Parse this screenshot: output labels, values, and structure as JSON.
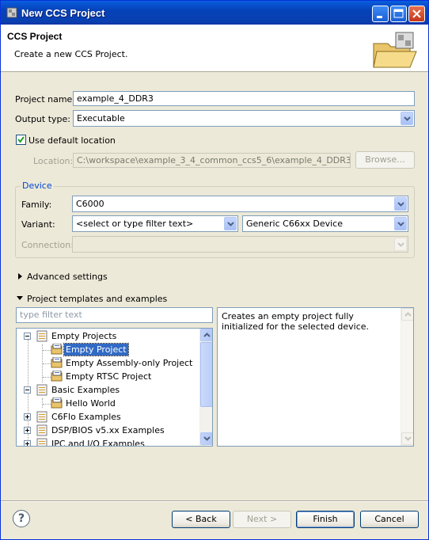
{
  "window": {
    "title": "New CCS Project"
  },
  "header": {
    "title": "CCS Project",
    "subtitle": "Create a new CCS Project."
  },
  "form": {
    "project_name_label": "Project name:",
    "project_name_value": "example_4_DDR3",
    "output_type_label": "Output type:",
    "output_type_value": "Executable",
    "use_default_location_label": "Use default location",
    "use_default_location_checked": true,
    "location_label": "Location:",
    "location_value": "C:\\workspace\\example_3_4_common_ccs5_6\\example_4_DDR3",
    "browse_label": "Browse..."
  },
  "device": {
    "group_title": "Device",
    "family_label": "Family:",
    "family_value": "C6000",
    "variant_label": "Variant:",
    "variant_filter_value": "<select or type filter text>",
    "variant_value": "Generic C66xx Device",
    "connection_label": "Connection:",
    "connection_value": ""
  },
  "advanced": {
    "label": "Advanced settings"
  },
  "templates": {
    "label": "Project templates and examples",
    "filter_placeholder": "type filter text",
    "description": "Creates an empty project fully initialized for the selected device.",
    "tree": [
      {
        "label": "Empty Projects",
        "level": 0,
        "expander": "minus"
      },
      {
        "label": "Empty Project",
        "level": 1,
        "selected": true
      },
      {
        "label": "Empty Assembly-only Project",
        "level": 1
      },
      {
        "label": "Empty RTSC Project",
        "level": 1
      },
      {
        "label": "Basic Examples",
        "level": 0,
        "expander": "minus"
      },
      {
        "label": "Hello World",
        "level": 1
      },
      {
        "label": "C6Flo Examples",
        "level": 0,
        "expander": "plus"
      },
      {
        "label": "DSP/BIOS v5.xx Examples",
        "level": 0,
        "expander": "plus"
      },
      {
        "label": "IPC and I/O Examples",
        "level": 0,
        "expander": "plus"
      }
    ]
  },
  "buttons": {
    "help_label": "?",
    "back_label": "< Back",
    "next_label": "Next >",
    "finish_label": "Finish",
    "cancel_label": "Cancel"
  },
  "colors": {
    "titlebar": "#0a4fcf",
    "selection": "#316ac5",
    "group_title": "#0046d5",
    "dialog_bg": "#ece9d8"
  }
}
